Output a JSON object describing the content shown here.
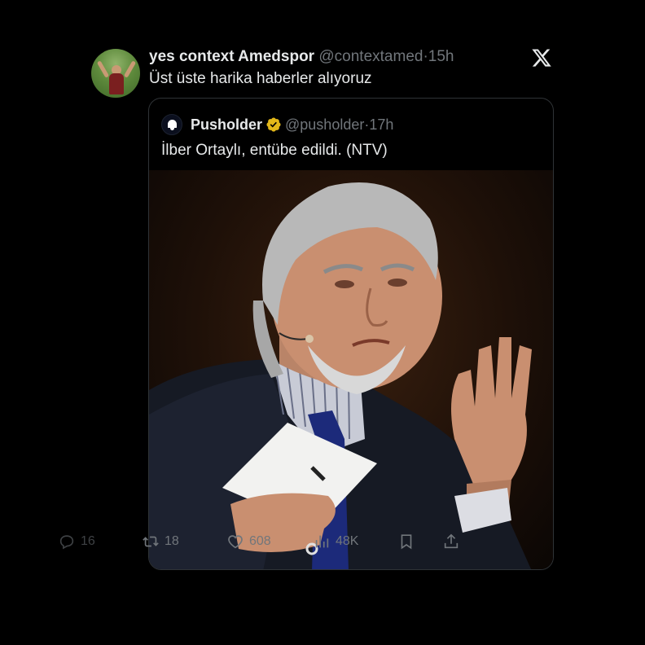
{
  "tweet": {
    "author_name": "yes context Amedspor",
    "handle": "@contextamed",
    "separator": "·",
    "time": "15h",
    "text": "Üst üste harika haberler alıyoruz"
  },
  "quote": {
    "author_name": "Pusholder",
    "handle": "@pusholder",
    "separator": "·",
    "time": "17h",
    "text": "İlber Ortaylı, entübe edildi. (NTV)"
  },
  "actions": {
    "replies": "16",
    "reposts": "18",
    "likes": "608",
    "views": "48K"
  },
  "icons": {
    "brand": "x-logo-icon",
    "verified": "gold-verified-badge-icon",
    "reply": "reply-icon",
    "repost": "repost-icon",
    "like": "heart-icon",
    "views": "views-chart-icon",
    "bookmark": "bookmark-icon",
    "share": "share-icon"
  },
  "colors": {
    "background": "#000000",
    "text": "#e7e9ea",
    "muted": "#71767b",
    "verified_gold": "#e2b719",
    "border": "#2f3336"
  }
}
